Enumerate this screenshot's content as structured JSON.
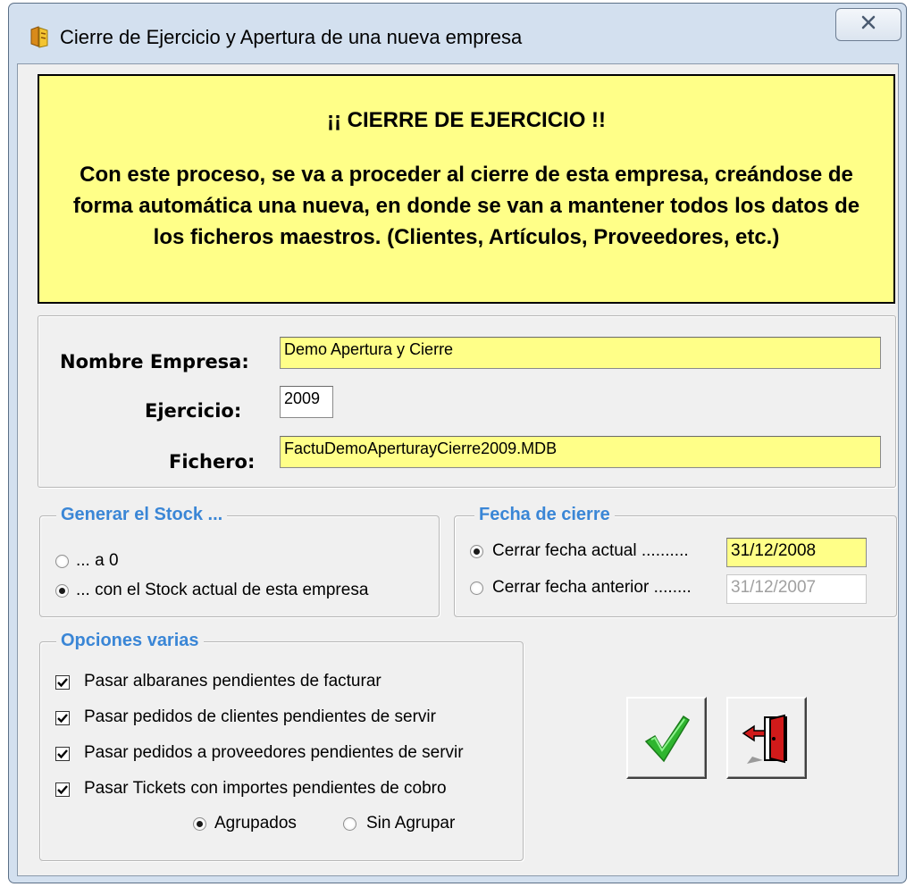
{
  "window": {
    "title": "Cierre de Ejercicio y Apertura de una nueva empresa",
    "close_label": "☒"
  },
  "warning": {
    "title": "¡¡ CIERRE DE EJERCICIO !!",
    "body": "Con este proceso, se va a proceder al cierre de esta empresa, creándose de forma automática una nueva, en donde se van a mantener todos los datos de los ficheros maestros. (Clientes, Artículos, Proveedores, etc.)",
    "bg_color": "#ffff88"
  },
  "company": {
    "name_label": "Nombre Empresa:",
    "name_value": "Demo Apertura y Cierre",
    "year_label": "Ejercicio:",
    "year_value": "2009",
    "file_label": "Fichero:",
    "file_value": "FactuDemoAperturayCierre2009.MDB"
  },
  "stock": {
    "legend": "Generar el Stock  ...",
    "options": [
      {
        "label": "... a 0",
        "selected": false
      },
      {
        "label": "... con el Stock actual de esta empresa",
        "selected": true
      }
    ]
  },
  "closing_date": {
    "legend": "Fecha de cierre",
    "options": [
      {
        "label": "Cerrar fecha actual ..........",
        "value": "31/12/2008",
        "selected": true
      },
      {
        "label": "Cerrar fecha anterior ........",
        "value": "31/12/2007",
        "selected": false
      }
    ]
  },
  "misc": {
    "legend": "Opciones varias",
    "checks": [
      {
        "label": "Pasar albaranes pendientes de facturar",
        "checked": true
      },
      {
        "label": "Pasar pedidos de clientes pendientes de servir",
        "checked": true
      },
      {
        "label": "Pasar pedidos a proveedores pendientes de servir",
        "checked": true
      },
      {
        "label": "Pasar Tickets con importes pendientes de cobro",
        "checked": true
      }
    ],
    "ticket_grouping": [
      {
        "label": "Agrupados",
        "selected": true
      },
      {
        "label": "Sin Agrupar",
        "selected": false
      }
    ]
  },
  "buttons": {
    "accept_icon": "green-checkmark-icon",
    "exit_icon": "exit-door-icon"
  },
  "colors": {
    "legend_blue": "#3a86d6",
    "field_yellow": "#ffff88",
    "check_green": "#2fb52f",
    "door_red": "#d11a1a"
  }
}
